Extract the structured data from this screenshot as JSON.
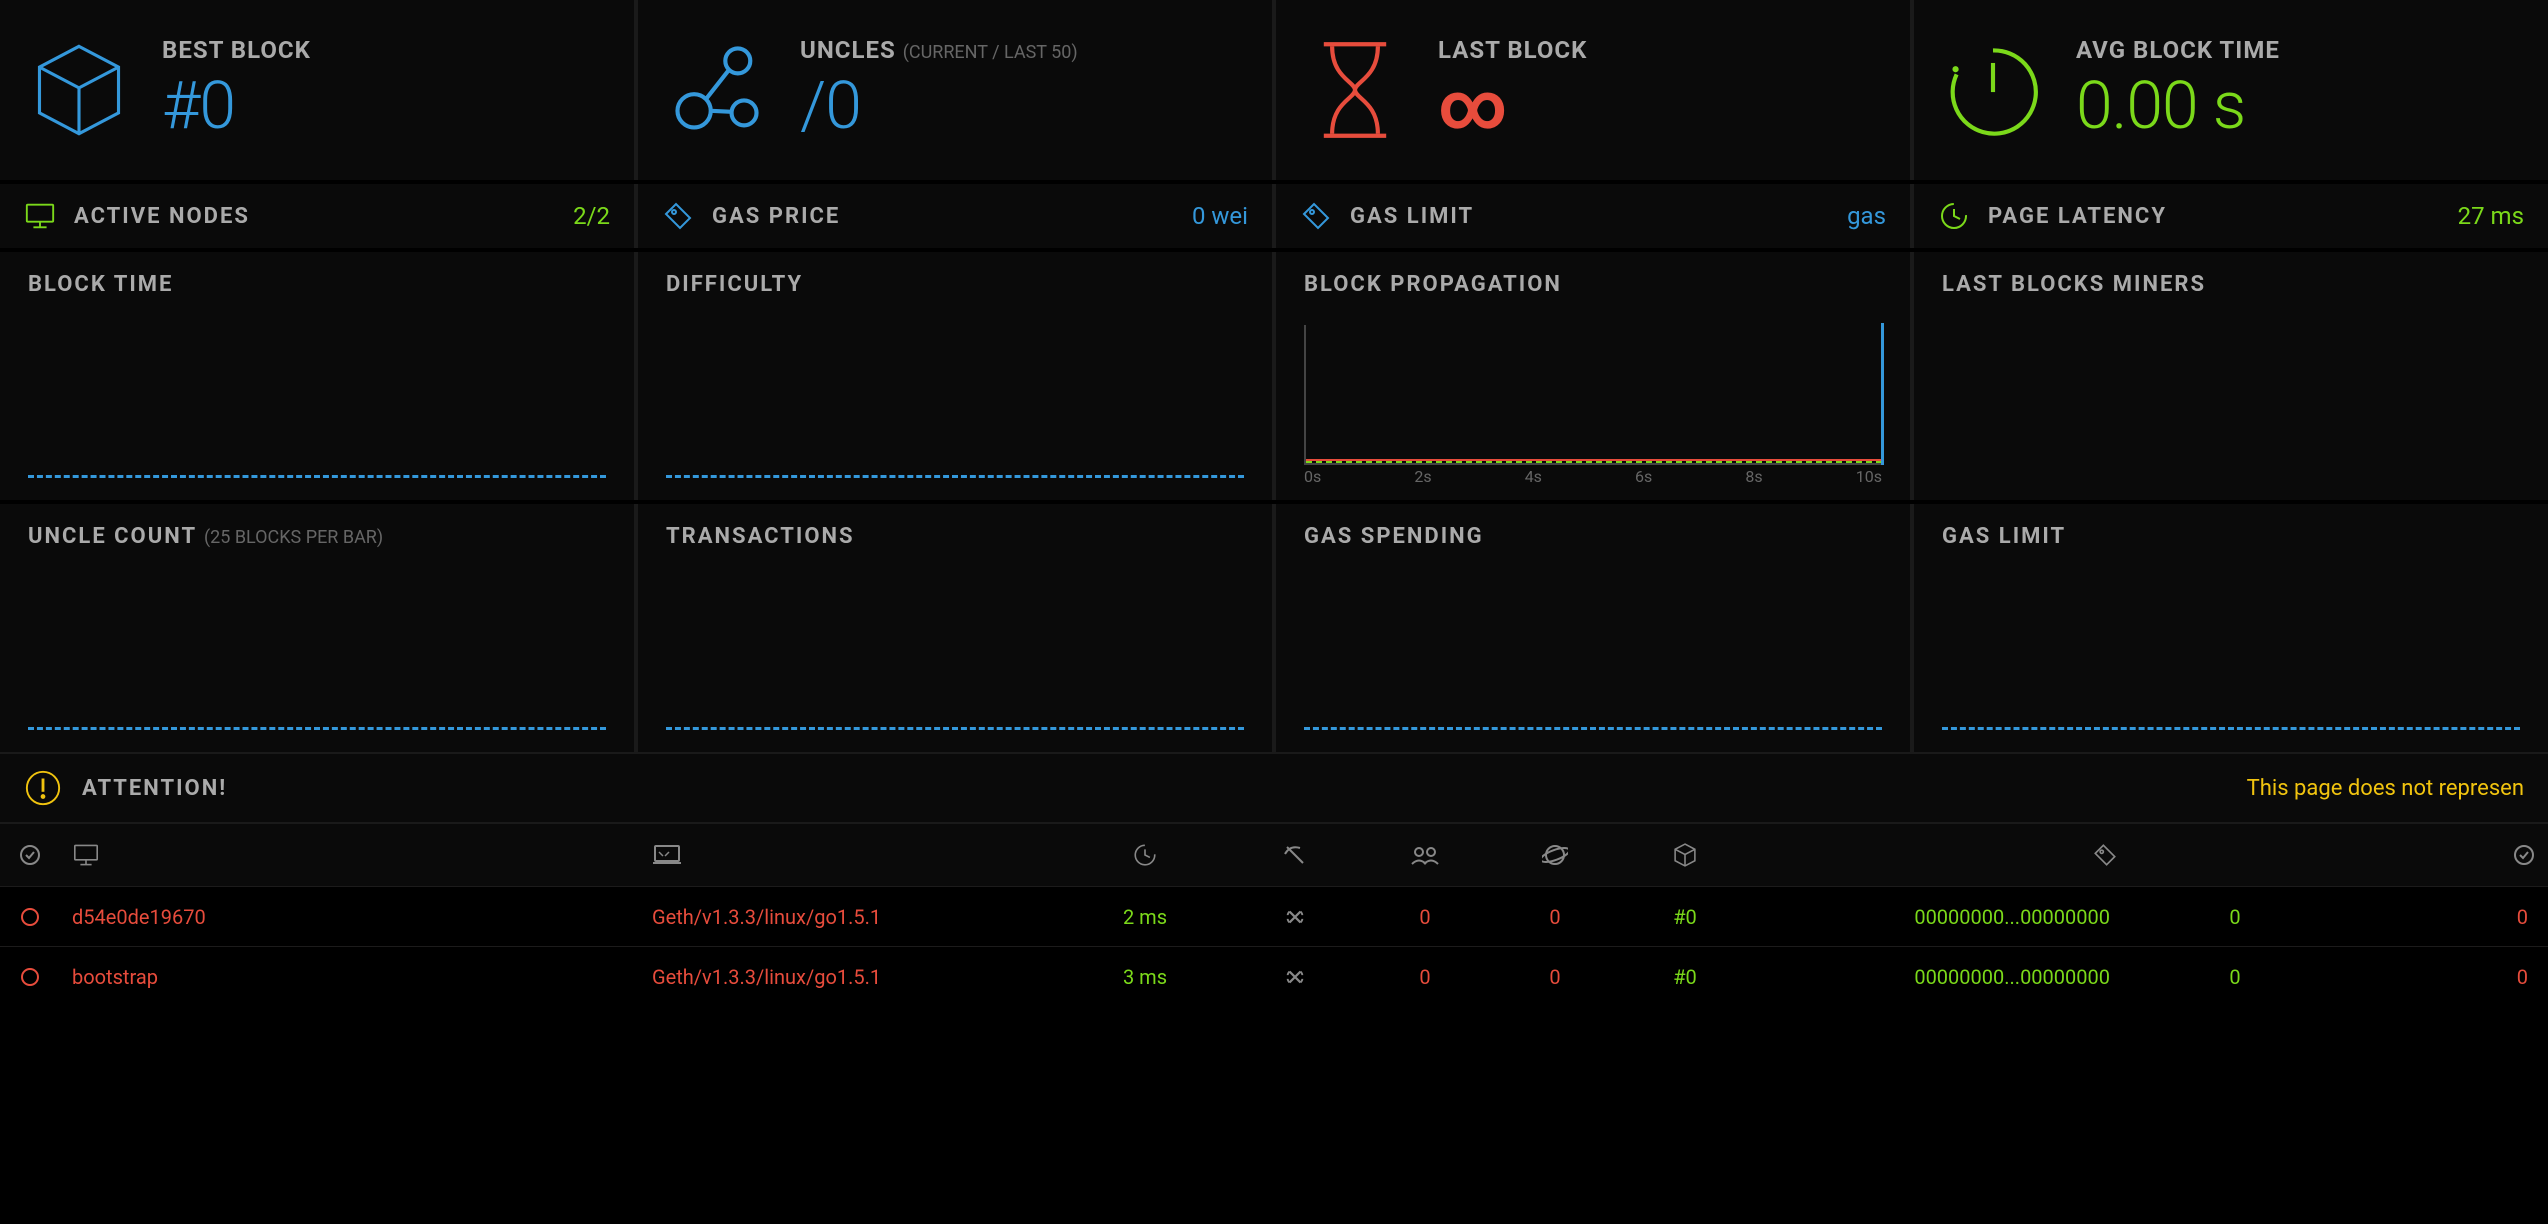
{
  "top": {
    "best_block": {
      "title": "BEST BLOCK",
      "value": "#0"
    },
    "uncles": {
      "title": "UNCLES",
      "sub": "(CURRENT / LAST 50)",
      "value": "/0"
    },
    "last_block": {
      "title": "LAST BLOCK",
      "value": "∞"
    },
    "avg_block_time": {
      "title": "AVG BLOCK TIME",
      "value": "0.00 s"
    }
  },
  "mid": {
    "active_nodes": {
      "label": "ACTIVE NODES",
      "value": "2/2"
    },
    "gas_price": {
      "label": "GAS PRICE",
      "value": "0 wei"
    },
    "gas_limit": {
      "label": "GAS LIMIT",
      "value": "gas"
    },
    "page_latency": {
      "label": "PAGE LATENCY",
      "value": "27 ms"
    }
  },
  "charts_row1": {
    "block_time": {
      "label": "BLOCK TIME"
    },
    "difficulty": {
      "label": "DIFFICULTY"
    },
    "block_propagation": {
      "label": "BLOCK PROPAGATION",
      "ticks": [
        "0s",
        "2s",
        "4s",
        "6s",
        "8s",
        "10s"
      ]
    },
    "last_blocks_miners": {
      "label": "LAST BLOCKS MINERS"
    }
  },
  "charts_row2": {
    "uncle_count": {
      "label": "UNCLE COUNT",
      "sub": "(25 BLOCKS PER BAR)"
    },
    "transactions": {
      "label": "TRANSACTIONS"
    },
    "gas_spending": {
      "label": "GAS SPENDING"
    },
    "gas_limit": {
      "label": "GAS LIMIT"
    }
  },
  "attention": {
    "label": "ATTENTION!",
    "message": "This page does not represen"
  },
  "table": {
    "icons": {
      "check": "check-circle-icon",
      "node": "computer-icon",
      "type": "laptop-icon",
      "latency": "clock-icon",
      "mining": "pickaxe-icon",
      "peers": "people-icon",
      "pending": "planet-icon",
      "block": "cube-icon",
      "hash": "tag-icon",
      "up": "check-circle-icon"
    },
    "rows": [
      {
        "name": "d54e0de19670",
        "type": "Geth/v1.3.3/linux/go1.5.1",
        "latency": "2 ms",
        "mining": "no",
        "peers": "0",
        "pending": "0",
        "block": "#0",
        "hash": "00000000...00000000",
        "txs": "0",
        "uncles": "0"
      },
      {
        "name": "bootstrap",
        "type": "Geth/v1.3.3/linux/go1.5.1",
        "latency": "3 ms",
        "mining": "no",
        "peers": "0",
        "pending": "0",
        "block": "#0",
        "hash": "00000000...00000000",
        "txs": "0",
        "uncles": "0"
      }
    ]
  },
  "chart_data": [
    {
      "type": "line",
      "title": "BLOCK TIME",
      "x": [],
      "values": []
    },
    {
      "type": "line",
      "title": "DIFFICULTY",
      "x": [],
      "values": []
    },
    {
      "type": "area",
      "title": "BLOCK PROPAGATION",
      "x": [
        0,
        2,
        4,
        6,
        8,
        10
      ],
      "values": [
        0,
        0,
        0,
        0,
        0,
        0
      ],
      "xlabel": "s"
    },
    {
      "type": "bar",
      "title": "LAST BLOCKS MINERS",
      "categories": [],
      "values": []
    },
    {
      "type": "bar",
      "title": "UNCLE COUNT",
      "categories": [],
      "values": []
    },
    {
      "type": "bar",
      "title": "TRANSACTIONS",
      "categories": [],
      "values": []
    },
    {
      "type": "bar",
      "title": "GAS SPENDING",
      "categories": [],
      "values": []
    },
    {
      "type": "bar",
      "title": "GAS LIMIT",
      "categories": [],
      "values": []
    }
  ]
}
